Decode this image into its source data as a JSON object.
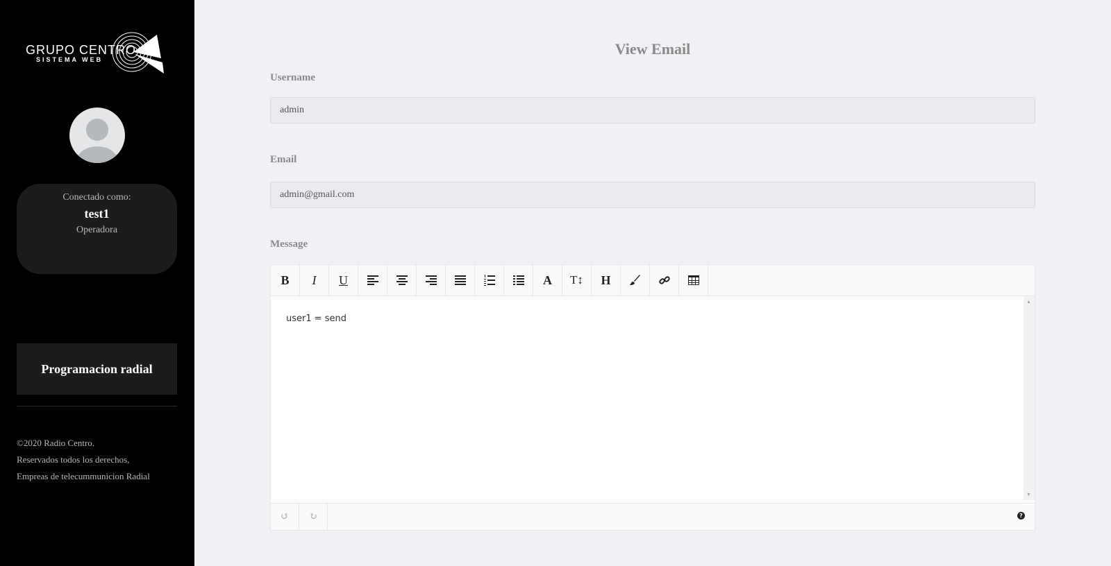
{
  "sidebar": {
    "logo_text": "GRUPO CENTRO",
    "logo_sub": "SISTEMA WEB",
    "user": {
      "connected_label": "Conectado como:",
      "username": "test1",
      "role": "Operadora"
    },
    "nav": [
      {
        "label": "Programacion radial"
      }
    ],
    "footer": {
      "line1": "©2020 Radio Centro.",
      "line2": "Reservados todos los derechos,",
      "line3": "Empreas de telecummunicion Radial"
    }
  },
  "main": {
    "title": "View Email",
    "username_label": "Username",
    "username_value": "admin",
    "email_label": "Email",
    "email_value": "admin@gmail.com",
    "message_label": "Message",
    "message_content": "user1 = send",
    "toolbar": [
      {
        "icon": "bold-icon",
        "glyph": "B"
      },
      {
        "icon": "italic-icon",
        "glyph": "I"
      },
      {
        "icon": "underline-icon",
        "glyph": "U"
      },
      {
        "icon": "align-left-icon",
        "glyph": ""
      },
      {
        "icon": "align-center-icon",
        "glyph": ""
      },
      {
        "icon": "align-right-icon",
        "glyph": ""
      },
      {
        "icon": "align-justify-icon",
        "glyph": ""
      },
      {
        "icon": "ordered-list-icon",
        "glyph": ""
      },
      {
        "icon": "unordered-list-icon",
        "glyph": ""
      },
      {
        "icon": "font-icon",
        "glyph": "A"
      },
      {
        "icon": "text-height-icon",
        "glyph": "T↕"
      },
      {
        "icon": "header-icon",
        "glyph": "H"
      },
      {
        "icon": "brush-icon",
        "glyph": ""
      },
      {
        "icon": "link-icon",
        "glyph": ""
      },
      {
        "icon": "table-icon",
        "glyph": ""
      }
    ]
  }
}
